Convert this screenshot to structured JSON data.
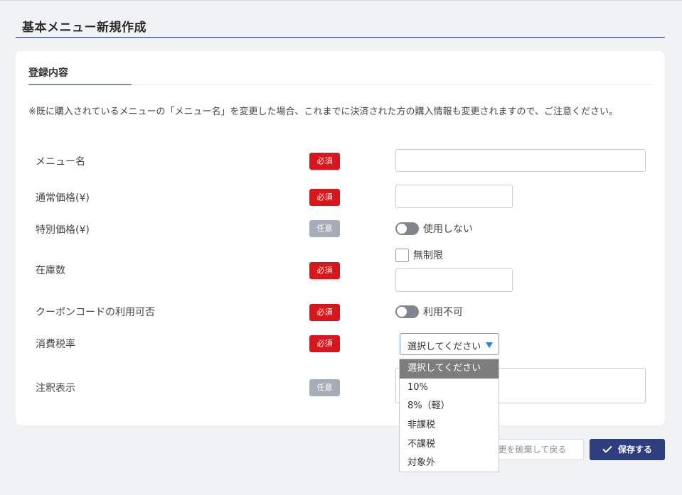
{
  "page": {
    "title": "基本メニュー新規作成"
  },
  "section": {
    "title": "登録内容"
  },
  "notice": "※既に購入されているメニューの「メニュー名」を変更した場合、これまでに決済された方の購入情報も変更されますので、ご注意ください。",
  "badges": {
    "required": "必須",
    "optional": "任意"
  },
  "fields": {
    "menu_name": {
      "label": "メニュー名",
      "value": ""
    },
    "regular_price": {
      "label": "通常価格(¥)",
      "value": ""
    },
    "special_price": {
      "label": "特別価格(¥)",
      "toggle_label": "使用しない",
      "enabled": false
    },
    "stock": {
      "label": "在庫数",
      "unlimited_label": "無制限",
      "value": ""
    },
    "coupon": {
      "label": "クーポンコードの利用可否",
      "toggle_label": "利用不可",
      "enabled": false
    },
    "tax_rate": {
      "label": "消費税率",
      "selected": "選択してください",
      "options": [
        "選択してください",
        "10%",
        "8%（軽）",
        "非課税",
        "不課税",
        "対象外"
      ]
    },
    "annotation": {
      "label": "注釈表示",
      "value": ""
    }
  },
  "buttons": {
    "back": "変更を破棄して戻る",
    "save": "保存する"
  },
  "colors": {
    "primary": "#2e3f80",
    "required": "#d9161b",
    "optional": "#a6adb8"
  }
}
